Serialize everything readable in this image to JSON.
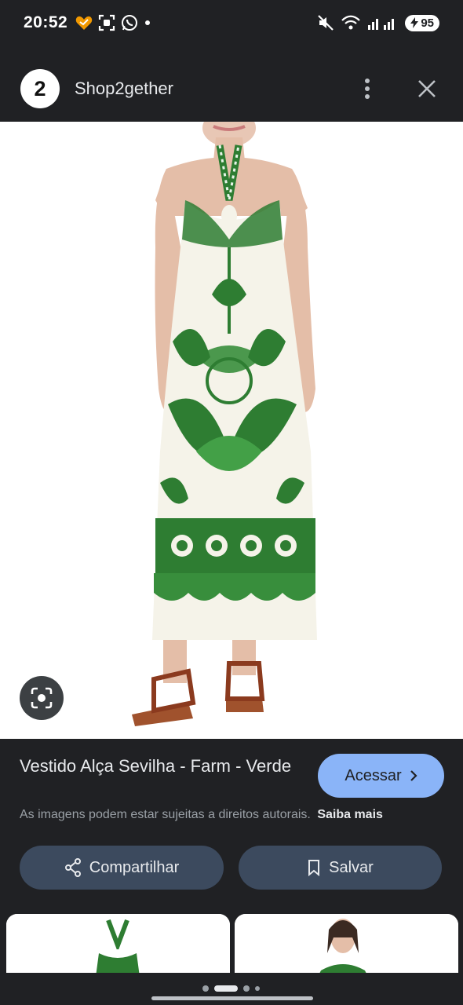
{
  "status_bar": {
    "time": "20:52",
    "battery": "95"
  },
  "app_bar": {
    "site_logo_text": "2",
    "site_name": "Shop2gether"
  },
  "product": {
    "title": "Vestido Alça Sevilha - Farm - Verde",
    "visit_label": "Acessar",
    "copyright_notice": "As imagens podem estar sujeitas a direitos autorais.",
    "learn_more": "Saiba mais",
    "share_label": "Compartilhar",
    "save_label": "Salvar"
  },
  "colors": {
    "background": "#202124",
    "accent_button": "#8ab4f8",
    "pill_button": "#3c4a5e",
    "print_green": "#2e7d32"
  },
  "icons": [
    "heart-icon",
    "screenshot-icon",
    "whatsapp-icon",
    "mute-icon",
    "wifi-icon",
    "signal-icon",
    "battery-icon",
    "more-vert-icon",
    "close-icon",
    "lens-icon",
    "chevron-right-icon",
    "share-icon",
    "bookmark-icon"
  ]
}
